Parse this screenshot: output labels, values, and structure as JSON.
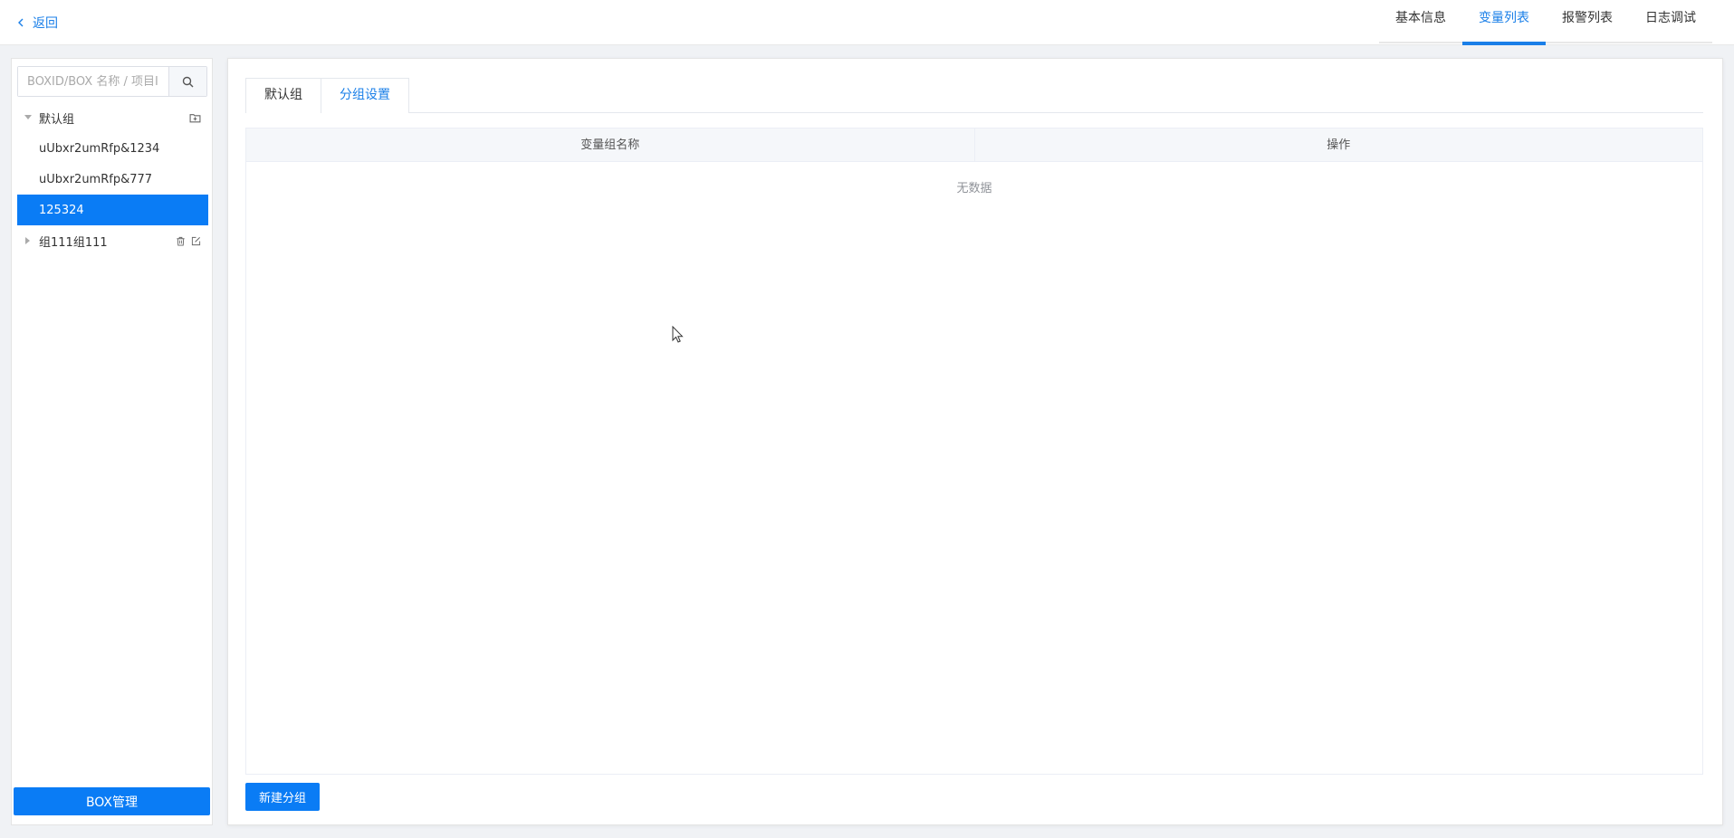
{
  "topbar": {
    "back_label": "返回",
    "tabs": [
      {
        "label": "基本信息"
      },
      {
        "label": "变量列表"
      },
      {
        "label": "报警列表"
      },
      {
        "label": "日志调试"
      }
    ],
    "active_tab": "变量列表"
  },
  "sidebar": {
    "search_placeholder": "BOXID/BOX 名称 / 项目ID",
    "tree": {
      "default_group": "默认组",
      "children": [
        {
          "label": "uUbxr2umRfp&1234"
        },
        {
          "label": "uUbxr2umRfp&777"
        },
        {
          "label": "125324"
        }
      ],
      "selected": "125324",
      "other_group": "组111组111"
    },
    "box_button": "BOX管理"
  },
  "main": {
    "tabs": [
      {
        "label": "默认组"
      },
      {
        "label": "分组设置"
      }
    ],
    "active_tab": "分组设置",
    "table": {
      "columns": [
        "变量组名称",
        "操作"
      ],
      "empty_text": "无数据"
    },
    "new_group_button": "新建分组"
  },
  "colors": {
    "primary": "#0a7cf5",
    "link": "#1a7fe8"
  }
}
